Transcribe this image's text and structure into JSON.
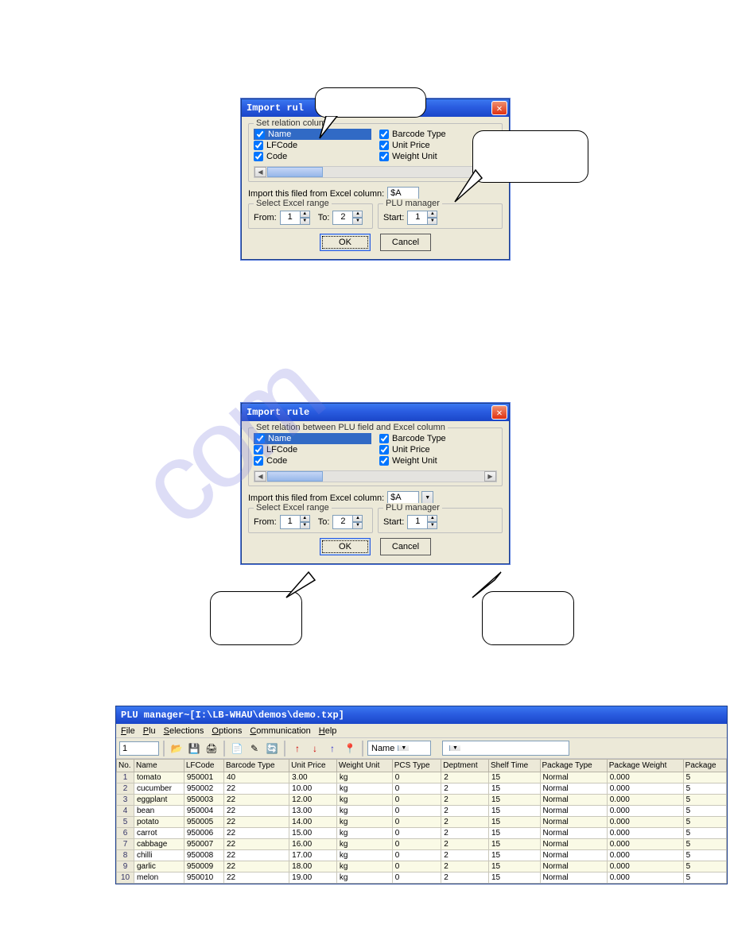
{
  "dialog": {
    "title_short": "Import rul",
    "title_full": "Import rule",
    "groupbox1_short": "Set relation                                            column",
    "groupbox1_full": "Set relation between PLU field and Excel column",
    "fields_left": [
      "Name",
      "LFCode",
      "Code"
    ],
    "fields_right": [
      "Barcode Type",
      "Unit Price",
      "Weight Unit"
    ],
    "import_label": "Import this filed from Excel column:",
    "import_value": "$A",
    "range_group": "Select Excel range",
    "from_lbl": "From:",
    "from_val": "1",
    "to_lbl": "To:",
    "to_val": "2",
    "plu_group": "PLU manager",
    "start_lbl": "Start:",
    "start_val": "1",
    "ok": "OK",
    "cancel": "Cancel"
  },
  "app": {
    "title": "PLU manager~[I:\\LB-WHAU\\demos\\demo.txp]",
    "menu": [
      "File",
      "Plu",
      "Selections",
      "Options",
      "Communication",
      "Help"
    ],
    "menu_underline": [
      "F",
      "P",
      "S",
      "O",
      "C",
      "H"
    ],
    "tb_number": "1",
    "dd1": "Name",
    "dd2": "",
    "headers": [
      "No.",
      "Name",
      "LFCode",
      "Barcode Type",
      "Unit Price",
      "Weight Unit",
      "PCS Type",
      "Deptment",
      "Shelf Time",
      "Package Type",
      "Package Weight",
      "Package"
    ],
    "rows": [
      [
        "1",
        "tomato",
        "950001",
        "40",
        "3.00",
        "kg",
        "0",
        "2",
        "15",
        "Normal",
        "0.000",
        "5"
      ],
      [
        "2",
        "cucumber",
        "950002",
        "22",
        "10.00",
        "kg",
        "0",
        "2",
        "15",
        "Normal",
        "0.000",
        "5"
      ],
      [
        "3",
        "eggplant",
        "950003",
        "22",
        "12.00",
        "kg",
        "0",
        "2",
        "15",
        "Normal",
        "0.000",
        "5"
      ],
      [
        "4",
        "bean",
        "950004",
        "22",
        "13.00",
        "kg",
        "0",
        "2",
        "15",
        "Normal",
        "0.000",
        "5"
      ],
      [
        "5",
        "potato",
        "950005",
        "22",
        "14.00",
        "kg",
        "0",
        "2",
        "15",
        "Normal",
        "0.000",
        "5"
      ],
      [
        "6",
        "carrot",
        "950006",
        "22",
        "15.00",
        "kg",
        "0",
        "2",
        "15",
        "Normal",
        "0.000",
        "5"
      ],
      [
        "7",
        "cabbage",
        "950007",
        "22",
        "16.00",
        "kg",
        "0",
        "2",
        "15",
        "Normal",
        "0.000",
        "5"
      ],
      [
        "8",
        "chilli",
        "950008",
        "22",
        "17.00",
        "kg",
        "0",
        "2",
        "15",
        "Normal",
        "0.000",
        "5"
      ],
      [
        "9",
        "garlic",
        "950009",
        "22",
        "18.00",
        "kg",
        "0",
        "2",
        "15",
        "Normal",
        "0.000",
        "5"
      ],
      [
        "10",
        "melon",
        "950010",
        "22",
        "19.00",
        "kg",
        "0",
        "2",
        "15",
        "Normal",
        "0.000",
        "5"
      ]
    ]
  }
}
